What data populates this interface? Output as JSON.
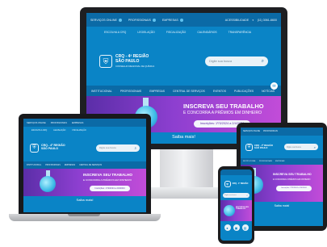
{
  "colors": {
    "brand_blue": "#0a84c6",
    "topbar_blue": "#0b6aa6",
    "banner_purple": "#8d3fd0"
  },
  "site": {
    "logo_line1": "CRQ - 4ª REGIÃO",
    "logo_line2": "SÃO PAULO",
    "logo_tagline": "CONSELHO REGIONAL DE QUÍMICA",
    "search_placeholder": "Digite sua busca",
    "access_label": "ACESSIBILIDADE",
    "phone": "(11) 3061-6600",
    "topbar_items": [
      "SERVIÇOS ONLINE",
      "PROFISSIONAIS",
      "EMPRESAS"
    ],
    "subnav": [
      "ESCOLHA A CRQ",
      "LEGISLAÇÃO",
      "FISCALIZAÇÃO",
      "CALENDÁRIOS",
      "TRANSPARÊNCIA"
    ],
    "menu": [
      "INSTITUCIONAL",
      "PROFISSIONAIS",
      "EMPRESAS",
      "CENTRAL DE SERVIÇOS",
      "EVENTOS",
      "PUBLICAÇÕES",
      "NOTÍCIAS"
    ],
    "banner_title": "INSCREVA SEU TRABALHO",
    "banner_subtitle": "E CONCORRA A PRÊMIOS EM DINHEIRO",
    "banner_button": "Inscrições: 1º/3/2024 a 2/4/2024",
    "saiba_mais": "Saiba mais!"
  },
  "icons": [
    "search-icon",
    "shield-logo-icon",
    "flask-icon",
    "chat-icon",
    "contrast-icon"
  ]
}
